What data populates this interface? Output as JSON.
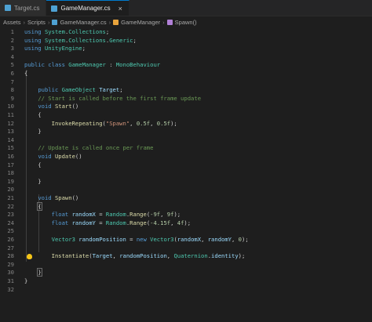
{
  "tabs": [
    {
      "label": "Target.cs",
      "active": false
    },
    {
      "label": "GameManager.cs",
      "active": true,
      "close": "×"
    }
  ],
  "breadcrumbs": [
    "Assets",
    "Scripts",
    "GameManager.cs",
    "GameManager",
    "Spawn()"
  ],
  "breadcrumb_sep": "›",
  "code": [
    {
      "n": "1",
      "t": [
        [
          "kw",
          "using "
        ],
        [
          "ty",
          "System"
        ],
        [
          "pl",
          "."
        ],
        [
          "ty",
          "Collections"
        ],
        [
          "pl",
          ";"
        ]
      ]
    },
    {
      "n": "2",
      "t": [
        [
          "kw",
          "using "
        ],
        [
          "ty",
          "System"
        ],
        [
          "pl",
          "."
        ],
        [
          "ty",
          "Collections"
        ],
        [
          "pl",
          "."
        ],
        [
          "ty",
          "Generic"
        ],
        [
          "pl",
          ";"
        ]
      ]
    },
    {
      "n": "3",
      "t": [
        [
          "kw",
          "using "
        ],
        [
          "ty",
          "UnityEngine"
        ],
        [
          "pl",
          ";"
        ]
      ]
    },
    {
      "n": "4",
      "t": []
    },
    {
      "n": "5",
      "t": [
        [
          "kw",
          "public class "
        ],
        [
          "ty",
          "GameManager"
        ],
        [
          "pl",
          " : "
        ],
        [
          "ty",
          "MonoBehaviour"
        ]
      ]
    },
    {
      "n": "6",
      "t": [
        [
          "pl",
          "{"
        ]
      ]
    },
    {
      "n": "7",
      "t": []
    },
    {
      "n": "8",
      "t": [
        [
          "pl",
          "    "
        ],
        [
          "kw",
          "public "
        ],
        [
          "ty",
          "GameObject "
        ],
        [
          "id",
          "Target"
        ],
        [
          "pl",
          ";"
        ]
      ]
    },
    {
      "n": "9",
      "t": [
        [
          "pl",
          "    "
        ],
        [
          "cm",
          "// Start is called before the first frame update"
        ]
      ]
    },
    {
      "n": "10",
      "t": [
        [
          "pl",
          "    "
        ],
        [
          "kw",
          "void "
        ],
        [
          "fn",
          "Start"
        ],
        [
          "pl",
          "()"
        ]
      ]
    },
    {
      "n": "11",
      "t": [
        [
          "pl",
          "    {"
        ]
      ]
    },
    {
      "n": "12",
      "t": [
        [
          "pl",
          "        "
        ],
        [
          "fn",
          "InvokeRepeating"
        ],
        [
          "pl",
          "("
        ],
        [
          "st",
          "\"Spawn\""
        ],
        [
          "pl",
          ", "
        ],
        [
          "nm",
          "0.5f"
        ],
        [
          "pl",
          ", "
        ],
        [
          "nm",
          "0.5f"
        ],
        [
          "pl",
          ");"
        ]
      ]
    },
    {
      "n": "13",
      "t": [
        [
          "pl",
          "    }"
        ]
      ]
    },
    {
      "n": "14",
      "t": []
    },
    {
      "n": "15",
      "t": [
        [
          "pl",
          "    "
        ],
        [
          "cm",
          "// Update is called once per frame"
        ]
      ]
    },
    {
      "n": "16",
      "t": [
        [
          "pl",
          "    "
        ],
        [
          "kw",
          "void "
        ],
        [
          "fn",
          "Update"
        ],
        [
          "pl",
          "()"
        ]
      ]
    },
    {
      "n": "17",
      "t": [
        [
          "pl",
          "    {"
        ]
      ]
    },
    {
      "n": "18",
      "t": []
    },
    {
      "n": "19",
      "t": [
        [
          "pl",
          "    }"
        ]
      ]
    },
    {
      "n": "20",
      "t": []
    },
    {
      "n": "21",
      "t": [
        [
          "pl",
          "    "
        ],
        [
          "kw",
          "void "
        ],
        [
          "fn",
          "Spawn"
        ],
        [
          "pl",
          "()"
        ]
      ]
    },
    {
      "n": "22",
      "t": [
        [
          "pl",
          "    "
        ],
        [
          "bx",
          "{"
        ]
      ]
    },
    {
      "n": "23",
      "t": [
        [
          "pl",
          "        "
        ],
        [
          "kw",
          "float "
        ],
        [
          "id",
          "randomX"
        ],
        [
          "pl",
          " = "
        ],
        [
          "ty",
          "Random"
        ],
        [
          "pl",
          "."
        ],
        [
          "fn",
          "Range"
        ],
        [
          "pl",
          "("
        ],
        [
          "nm",
          "-9f"
        ],
        [
          "pl",
          ", "
        ],
        [
          "nm",
          "9f"
        ],
        [
          "pl",
          ");"
        ]
      ]
    },
    {
      "n": "24",
      "t": [
        [
          "pl",
          "        "
        ],
        [
          "kw",
          "float "
        ],
        [
          "id",
          "randomY"
        ],
        [
          "pl",
          " = "
        ],
        [
          "ty",
          "Random"
        ],
        [
          "pl",
          "."
        ],
        [
          "fn",
          "Range"
        ],
        [
          "pl",
          "("
        ],
        [
          "nm",
          "-4.15f"
        ],
        [
          "pl",
          ", "
        ],
        [
          "nm",
          "4f"
        ],
        [
          "pl",
          ");"
        ]
      ]
    },
    {
      "n": "25",
      "t": []
    },
    {
      "n": "26",
      "t": [
        [
          "pl",
          "        "
        ],
        [
          "ty",
          "Vector3 "
        ],
        [
          "id",
          "randomPosition"
        ],
        [
          "pl",
          " = "
        ],
        [
          "kw",
          "new "
        ],
        [
          "ty",
          "Vector3"
        ],
        [
          "pl",
          "("
        ],
        [
          "id",
          "randomX"
        ],
        [
          "pl",
          ", "
        ],
        [
          "id",
          "randomY"
        ],
        [
          "pl",
          ", "
        ],
        [
          "nm",
          "0"
        ],
        [
          "pl",
          ");"
        ]
      ]
    },
    {
      "n": "27",
      "t": []
    },
    {
      "n": "28",
      "t": [
        [
          "pl",
          "        "
        ],
        [
          "fn",
          "Instantiate"
        ],
        [
          "pl",
          "("
        ],
        [
          "id",
          "Target"
        ],
        [
          "pl",
          ", "
        ],
        [
          "id",
          "randomPosition"
        ],
        [
          "pl",
          ", "
        ],
        [
          "ty",
          "Quaternion"
        ],
        [
          "pl",
          "."
        ],
        [
          "id",
          "identity"
        ],
        [
          "pl",
          ");"
        ]
      ]
    },
    {
      "n": "29",
      "t": []
    },
    {
      "n": "30",
      "t": [
        [
          "pl",
          "    "
        ],
        [
          "bx",
          "}"
        ]
      ]
    },
    {
      "n": "31",
      "t": [
        [
          "pl",
          "}"
        ]
      ]
    },
    {
      "n": "32",
      "t": []
    }
  ],
  "lightbulb_line": "28",
  "colors": {
    "background": "#1e1e1e",
    "keyword": "#569cd6",
    "type": "#4ec9b0",
    "function": "#dcdcaa",
    "comment": "#6a9955",
    "number": "#b5cea8",
    "string": "#ce9178",
    "identifier": "#9cdcfe"
  },
  "icons": [
    "csharp-file-icon",
    "close-icon",
    "class-icon",
    "method-icon",
    "lightbulb-icon"
  ]
}
